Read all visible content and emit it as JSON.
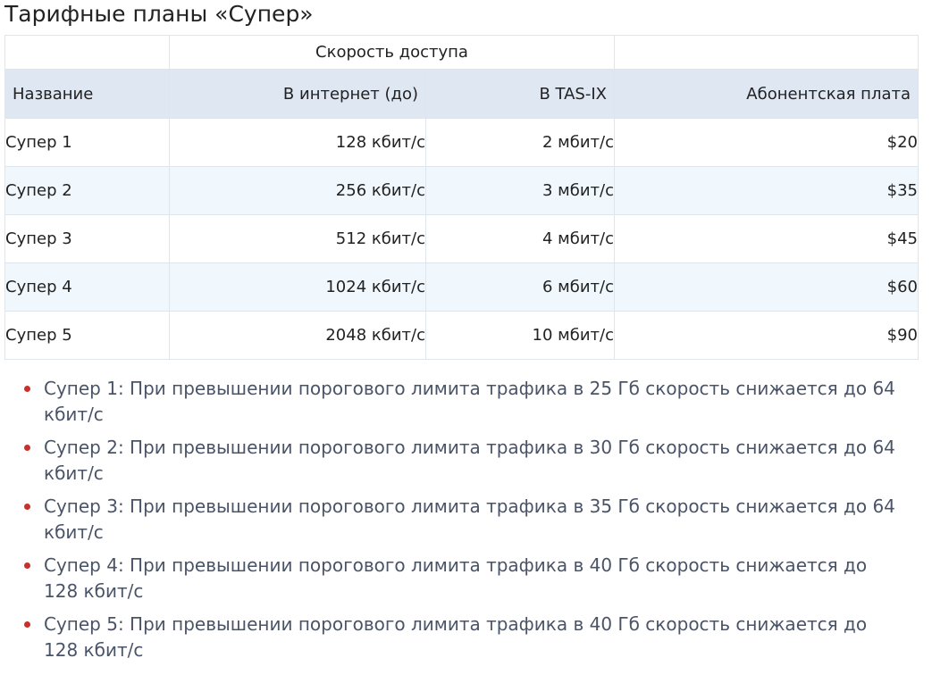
{
  "page": {
    "title": "Тарифные планы «Супер»"
  },
  "table": {
    "group_header": "Скорость доступа",
    "headers": {
      "name": "Название",
      "internet": "В интернет (до)",
      "tasix": "В TAS-IX",
      "fee": "Абонентская плата"
    },
    "rows": [
      {
        "name": "Супер 1",
        "internet": "128 кбит/с",
        "tasix": "2 мбит/с",
        "fee": "$20"
      },
      {
        "name": "Супер 2",
        "internet": "256 кбит/с",
        "tasix": "3 мбит/с",
        "fee": "$35"
      },
      {
        "name": "Супер 3",
        "internet": "512 кбит/с",
        "tasix": "4 мбит/с",
        "fee": "$45"
      },
      {
        "name": "Супер 4",
        "internet": "1024 кбит/с",
        "tasix": "6 мбит/с",
        "fee": "$60"
      },
      {
        "name": "Супер 5",
        "internet": "2048 кбит/с",
        "tasix": "10 мбит/с",
        "fee": "$90"
      }
    ]
  },
  "notes": [
    "Супер 1: При превышении порогового лимита трафика в 25 Гб скорость снижается до 64 кбит/с",
    "Супер 2: При превышении порогового лимита трафика в 30 Гб скорость снижается до 64 кбит/с",
    "Супер 3: При превышении порогового лимита трафика в 35 Гб скорость снижается до 64 кбит/с",
    "Супер 4: При превышении порогового лимита трафика в 40 Гб скорость снижается до 128 кбит/с",
    "Супер 5: При превышении порогового лимита трафика в 40 Гб скорость снижается до 128 кбит/с"
  ],
  "colors": {
    "header_bg": "#dfe7f3",
    "stripe_bg": "#f1f8fd",
    "bullet": "#c9302c",
    "note_text": "#4a5468"
  }
}
